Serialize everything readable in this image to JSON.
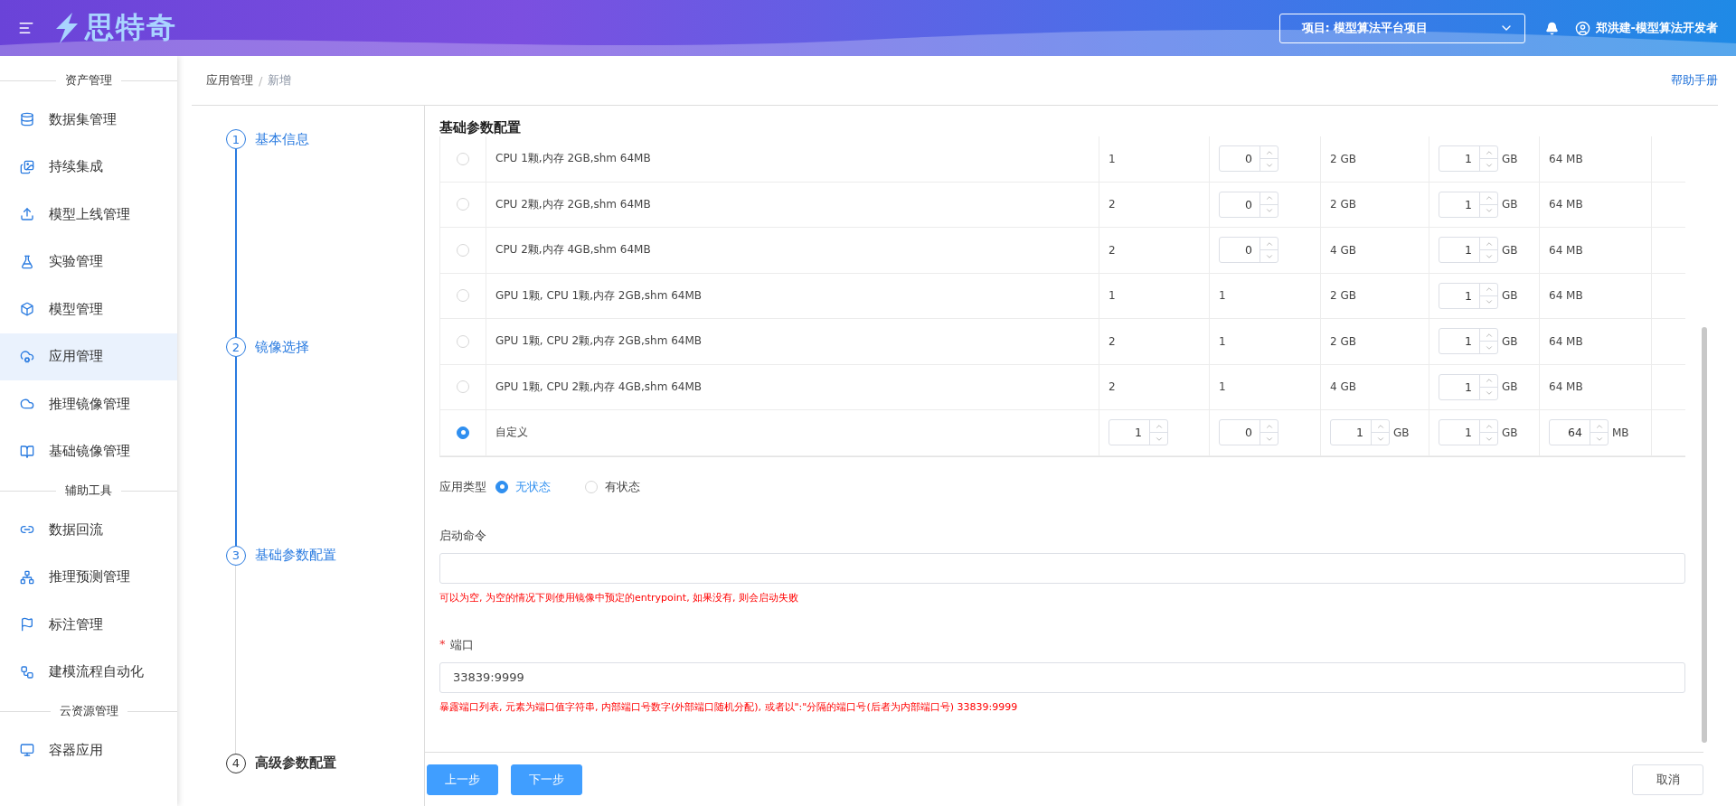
{
  "header": {
    "logo_text": "思特奇",
    "project": "项目: 模型算法平台项目",
    "user": "郑洪建-模型算法开发者"
  },
  "sidebar": {
    "groups": [
      {
        "title": "资产管理",
        "items": [
          {
            "label": "数据集管理",
            "selected": false
          },
          {
            "label": "持续集成",
            "selected": false
          },
          {
            "label": "模型上线管理",
            "selected": false
          },
          {
            "label": "实验管理",
            "selected": false
          },
          {
            "label": "模型管理",
            "selected": false
          },
          {
            "label": "应用管理",
            "selected": true
          },
          {
            "label": "推理镜像管理",
            "selected": false
          },
          {
            "label": "基础镜像管理",
            "selected": false
          }
        ]
      },
      {
        "title": "辅助工具",
        "items": [
          {
            "label": "数据回流",
            "selected": false
          },
          {
            "label": "推理预测管理",
            "selected": false
          },
          {
            "label": "标注管理",
            "selected": false
          },
          {
            "label": "建模流程自动化",
            "selected": false
          }
        ]
      },
      {
        "title": "云资源管理",
        "items": [
          {
            "label": "容器应用",
            "selected": false
          }
        ]
      }
    ]
  },
  "breadcrumb": [
    {
      "label": "应用管理",
      "current": false
    },
    {
      "label": "新增",
      "current": true
    }
  ],
  "breadcrumb_separator": "/",
  "help_link": "帮助手册",
  "steps": [
    {
      "number": "1",
      "label": "基本信息",
      "active": true
    },
    {
      "number": "2",
      "label": "镜像选择",
      "active": true
    },
    {
      "number": "3",
      "label": "基础参数配置",
      "active": true
    },
    {
      "number": "4",
      "label": "高级参数配置",
      "active": false
    }
  ],
  "section_title": "基础参数配置",
  "table": {
    "rows": [
      {
        "selected": false,
        "cells": [
          {
            "kind": "text",
            "value": "CPU 1颗,内存 2GB,shm 64MB"
          },
          {
            "kind": "text",
            "value": "1"
          },
          {
            "kind": "stepper",
            "value": "0"
          },
          {
            "kind": "text",
            "value": "2 GB"
          },
          {
            "kind": "stepper",
            "value": "1",
            "unit": "GB"
          },
          {
            "kind": "text",
            "value": "64 MB"
          }
        ]
      },
      {
        "selected": false,
        "cells": [
          {
            "kind": "text",
            "value": "CPU 2颗,内存 2GB,shm 64MB"
          },
          {
            "kind": "text",
            "value": "2"
          },
          {
            "kind": "stepper",
            "value": "0"
          },
          {
            "kind": "text",
            "value": "2 GB"
          },
          {
            "kind": "stepper",
            "value": "1",
            "unit": "GB"
          },
          {
            "kind": "text",
            "value": "64 MB"
          }
        ]
      },
      {
        "selected": false,
        "cells": [
          {
            "kind": "text",
            "value": "CPU 2颗,内存 4GB,shm 64MB"
          },
          {
            "kind": "text",
            "value": "2"
          },
          {
            "kind": "stepper",
            "value": "0"
          },
          {
            "kind": "text",
            "value": "4 GB"
          },
          {
            "kind": "stepper",
            "value": "1",
            "unit": "GB"
          },
          {
            "kind": "text",
            "value": "64 MB"
          }
        ]
      },
      {
        "selected": false,
        "cells": [
          {
            "kind": "text",
            "value": "GPU 1颗, CPU 1颗,内存 2GB,shm 64MB"
          },
          {
            "kind": "text",
            "value": "1"
          },
          {
            "kind": "text",
            "value": "1"
          },
          {
            "kind": "text",
            "value": "2 GB"
          },
          {
            "kind": "stepper",
            "value": "1",
            "unit": "GB"
          },
          {
            "kind": "text",
            "value": "64 MB"
          }
        ]
      },
      {
        "selected": false,
        "cells": [
          {
            "kind": "text",
            "value": "GPU 1颗, CPU 2颗,内存 2GB,shm 64MB"
          },
          {
            "kind": "text",
            "value": "2"
          },
          {
            "kind": "text",
            "value": "1"
          },
          {
            "kind": "text",
            "value": "2 GB"
          },
          {
            "kind": "stepper",
            "value": "1",
            "unit": "GB"
          },
          {
            "kind": "text",
            "value": "64 MB"
          }
        ]
      },
      {
        "selected": false,
        "cells": [
          {
            "kind": "text",
            "value": "GPU 1颗, CPU 2颗,内存 4GB,shm 64MB"
          },
          {
            "kind": "text",
            "value": "2"
          },
          {
            "kind": "text",
            "value": "1"
          },
          {
            "kind": "text",
            "value": "4 GB"
          },
          {
            "kind": "stepper",
            "value": "1",
            "unit": "GB"
          },
          {
            "kind": "text",
            "value": "64 MB"
          }
        ]
      },
      {
        "selected": true,
        "cells": [
          {
            "kind": "text",
            "value": "自定义"
          },
          {
            "kind": "stepper",
            "value": "1"
          },
          {
            "kind": "stepper",
            "value": "0"
          },
          {
            "kind": "stepper",
            "value": "1",
            "unit": "GB"
          },
          {
            "kind": "stepper",
            "value": "1",
            "unit": "GB"
          },
          {
            "kind": "stepper",
            "value": "64",
            "unit": "MB"
          }
        ]
      }
    ]
  },
  "app_type": {
    "label": "应用类型",
    "options": [
      {
        "label": "无状态",
        "selected": true
      },
      {
        "label": "有状态",
        "selected": false
      }
    ]
  },
  "command": {
    "label": "启动命令",
    "hint": "可以为空, 为空的情况下则使用镜像中预定的entrypoint, 如果没有, 则会启动失败"
  },
  "port": {
    "label": "端口",
    "required_mark": "*",
    "value": "33839:9999",
    "hint": "暴露端口列表, 元素为端口值字符串, 内部端口号数字(外部端口随机分配), 或者以\":\"分隔的端口号(后者为内部端口号) 33839:9999"
  },
  "buttons": {
    "prev": "上一步",
    "next": "下一步",
    "cancel": "取消"
  }
}
